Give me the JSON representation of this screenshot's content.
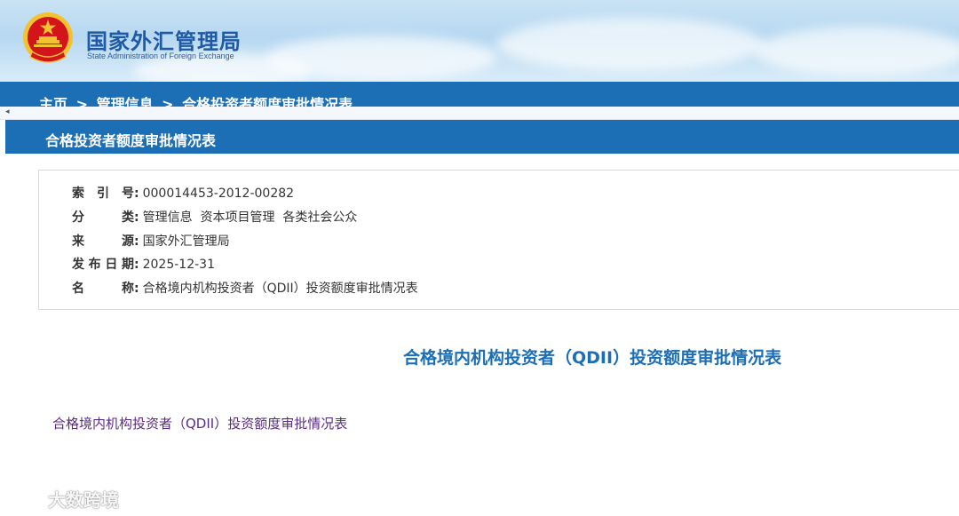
{
  "header": {
    "logo_cn": "国家外汇管理局",
    "logo_en": "State Administration of Foreign Exchange"
  },
  "breadcrumb": {
    "items": [
      "主页",
      "管理信息",
      "合格投资者额度审批情况表"
    ],
    "separator": ">"
  },
  "page_title": "合格投资者额度审批情况表",
  "meta": {
    "index": {
      "label": "索引号",
      "value": "000014453-2012-00282"
    },
    "category": {
      "label": "分类",
      "value": "管理信息  资本项目管理  各类社会公众"
    },
    "source": {
      "label": "来源",
      "value": "国家外汇管理局"
    },
    "date": {
      "label": "发布日期",
      "value": "2025-12-31"
    },
    "name": {
      "label": "名称",
      "value": "合格境内机构投资者（QDII）投资额度审批情况表"
    }
  },
  "document": {
    "title": "合格境内机构投资者（QDII）投资额度审批情况表",
    "link_text": "合格境内机构投资者（QDII）投资额度审批情况表"
  },
  "watermark": {
    "text": "大数跨境"
  },
  "colors": {
    "primary_blue": "#1c6fb5",
    "link_purple": "#5b2c83",
    "emblem_red": "#d3141b",
    "emblem_gold": "#f2c230"
  },
  "icons": {
    "emblem": "national-emblem-icon",
    "scroll_left": "arrow-left-icon",
    "watermark_logo": "watermark-logo-icon"
  }
}
